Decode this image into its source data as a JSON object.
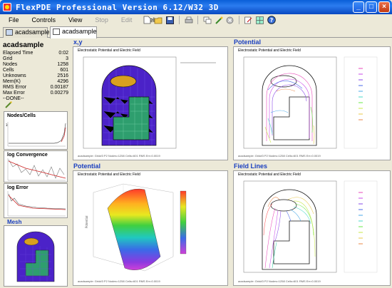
{
  "window": {
    "title": "FlexPDE Professional Version 6.12/W32 3D"
  },
  "menu": {
    "file": "File",
    "controls": "Controls",
    "view": "View",
    "stop": "Stop",
    "edit": "Edit",
    "help": "Help"
  },
  "tabs": [
    {
      "label": "acadsample"
    },
    {
      "label": "acadsample"
    }
  ],
  "summary": {
    "title": "acadsample",
    "rows": [
      {
        "label": "Elapsed Time",
        "value": "0:02"
      },
      {
        "label": "Grid",
        "value": "3"
      },
      {
        "label": "Nodes",
        "value": "1258"
      },
      {
        "label": "Cells",
        "value": "601"
      },
      {
        "label": "Unknowns",
        "value": "2516"
      },
      {
        "label": "Mem(K)",
        "value": "4296"
      },
      {
        "label": "RMS Error",
        "value": "0.00187"
      },
      {
        "label": "Max Error",
        "value": "0.00279"
      }
    ],
    "status": "--DONE--"
  },
  "monitors": {
    "nodes_cells": "Nodes/Cells",
    "convergence": "log Convergence",
    "error": "log Error",
    "mesh": "Mesh"
  },
  "panels": {
    "xy": {
      "title": "x,y",
      "heading": "Electrostatic Potential and Electric Field"
    },
    "potential_contour": {
      "title": "Potential",
      "heading": "Electrostatic Potential and Electric Field"
    },
    "potential_surface": {
      "title": "Potential",
      "heading": "Electrostatic Potential and Electric Field"
    },
    "field_lines": {
      "title": "Field Lines",
      "heading": "Electrostatic Potential and Electric Field"
    }
  },
  "colors": {
    "accent": "#1a3fc0",
    "mesh_fill": "#4b22c8",
    "conductor": "#2e9e6e",
    "ellipse": "#d8a020"
  }
}
